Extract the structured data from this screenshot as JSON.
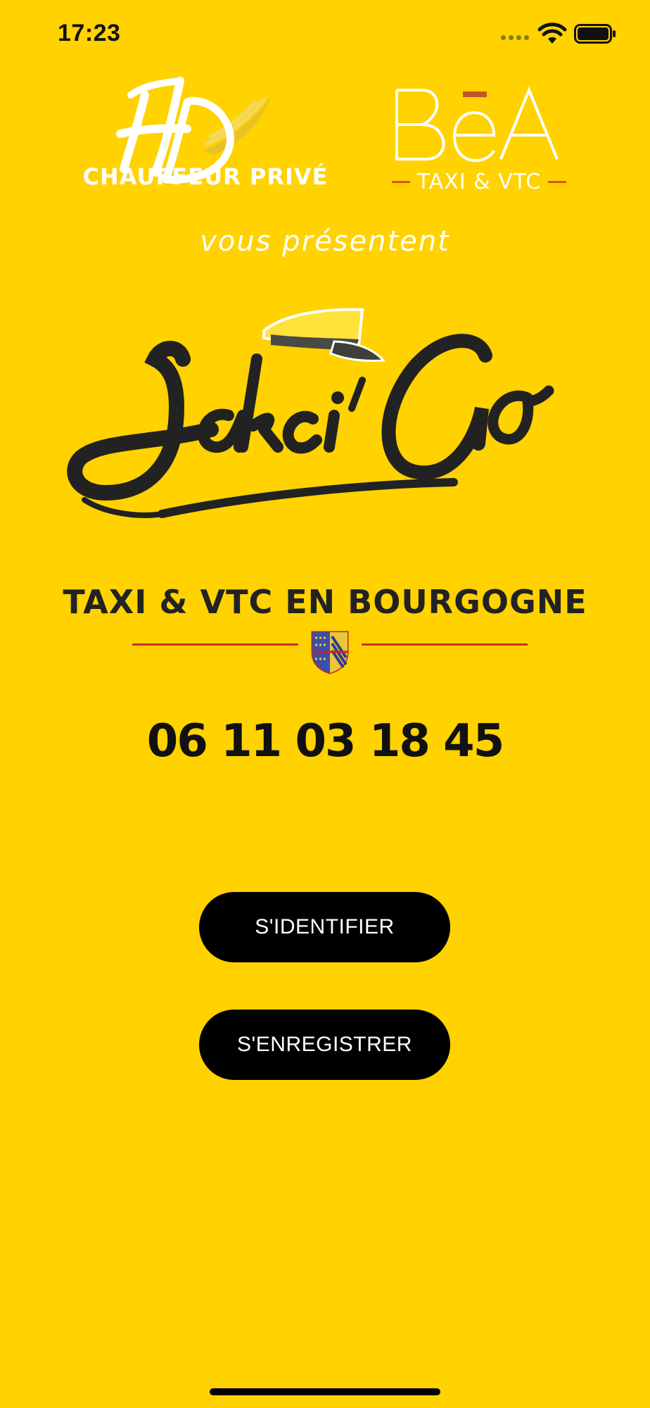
{
  "status_bar": {
    "time": "17:23",
    "wifi_icon": "wifi-icon",
    "battery_icon": "battery-icon"
  },
  "partners": {
    "hd": {
      "monogram": "HD",
      "label": "CHAUFFEUR PRIVÉ"
    },
    "bea": {
      "wordmark": "BēA",
      "label": "TAXI & VTC"
    },
    "presents": "vous présentent"
  },
  "brand": {
    "name": "Jakci´Go",
    "tagline": "TAXI & VTC EN BOURGOGNE",
    "phone": "06 11 03 18 45"
  },
  "actions": {
    "login_label": "S'IDENTIFIER",
    "register_label": "S'ENREGISTRER"
  },
  "colors": {
    "background": "#FFD200",
    "button": "#000000",
    "accent_red": "#D22D2A"
  }
}
